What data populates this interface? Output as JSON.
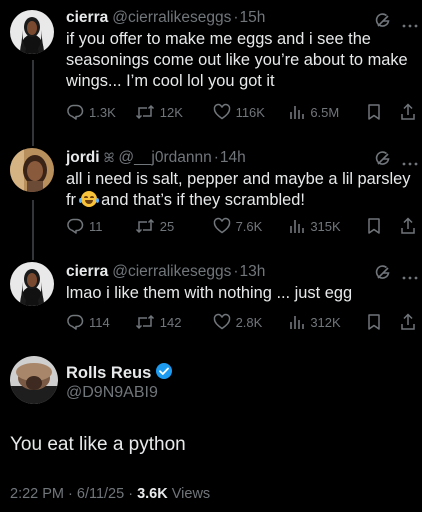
{
  "tweets": [
    {
      "name": "cierra",
      "handle": "@cierralikeseggs",
      "separator": "·",
      "time": "15h",
      "name_glyph": "",
      "text": "if you offer to make me eggs and i see the seasonings come out like you’re about to make wings... I’m cool lol you got it",
      "replies": "1.3K",
      "retweets": "12K",
      "likes": "116K",
      "views": "6.5M"
    },
    {
      "name": "jordi",
      "name_glyph": "ꕤ",
      "handle": "@__j0rdannn",
      "separator": "·",
      "time": "14h",
      "text_before_emoji": "all i need is salt, pepper and maybe a lil parsley fr",
      "text_after_emoji": "and that’s if they scrambled!",
      "replies": "11",
      "retweets": "25",
      "likes": "7.6K",
      "views": "315K"
    },
    {
      "name": "cierra",
      "handle": "@cierralikeseggs",
      "separator": "·",
      "time": "13h",
      "name_glyph": "",
      "text": "lmao i like them with nothing ... just egg",
      "replies": "114",
      "retweets": "142",
      "likes": "2.8K",
      "views": "312K"
    }
  ],
  "main_tweet": {
    "name": "Rolls Reus",
    "handle": "@D9N9ABI9",
    "text": "You eat like a python",
    "time": "2:22 PM · 6/11/25 · ",
    "views_count": "3.6K",
    "views_label": " Views"
  },
  "icons": {
    "reply": "reply-icon",
    "retweet": "retweet-icon",
    "like": "heart-icon",
    "views": "views-icon",
    "bookmark": "bookmark-icon",
    "share": "share-icon",
    "grok": "grok-icon",
    "more": "more-icon",
    "verified": "verified-badge-icon",
    "emoji": "laughing-tears-emoji"
  },
  "colors": {
    "background": "#000000",
    "text": "#e7e9ea",
    "muted": "#71767b",
    "verified": "#1d9bf0"
  }
}
